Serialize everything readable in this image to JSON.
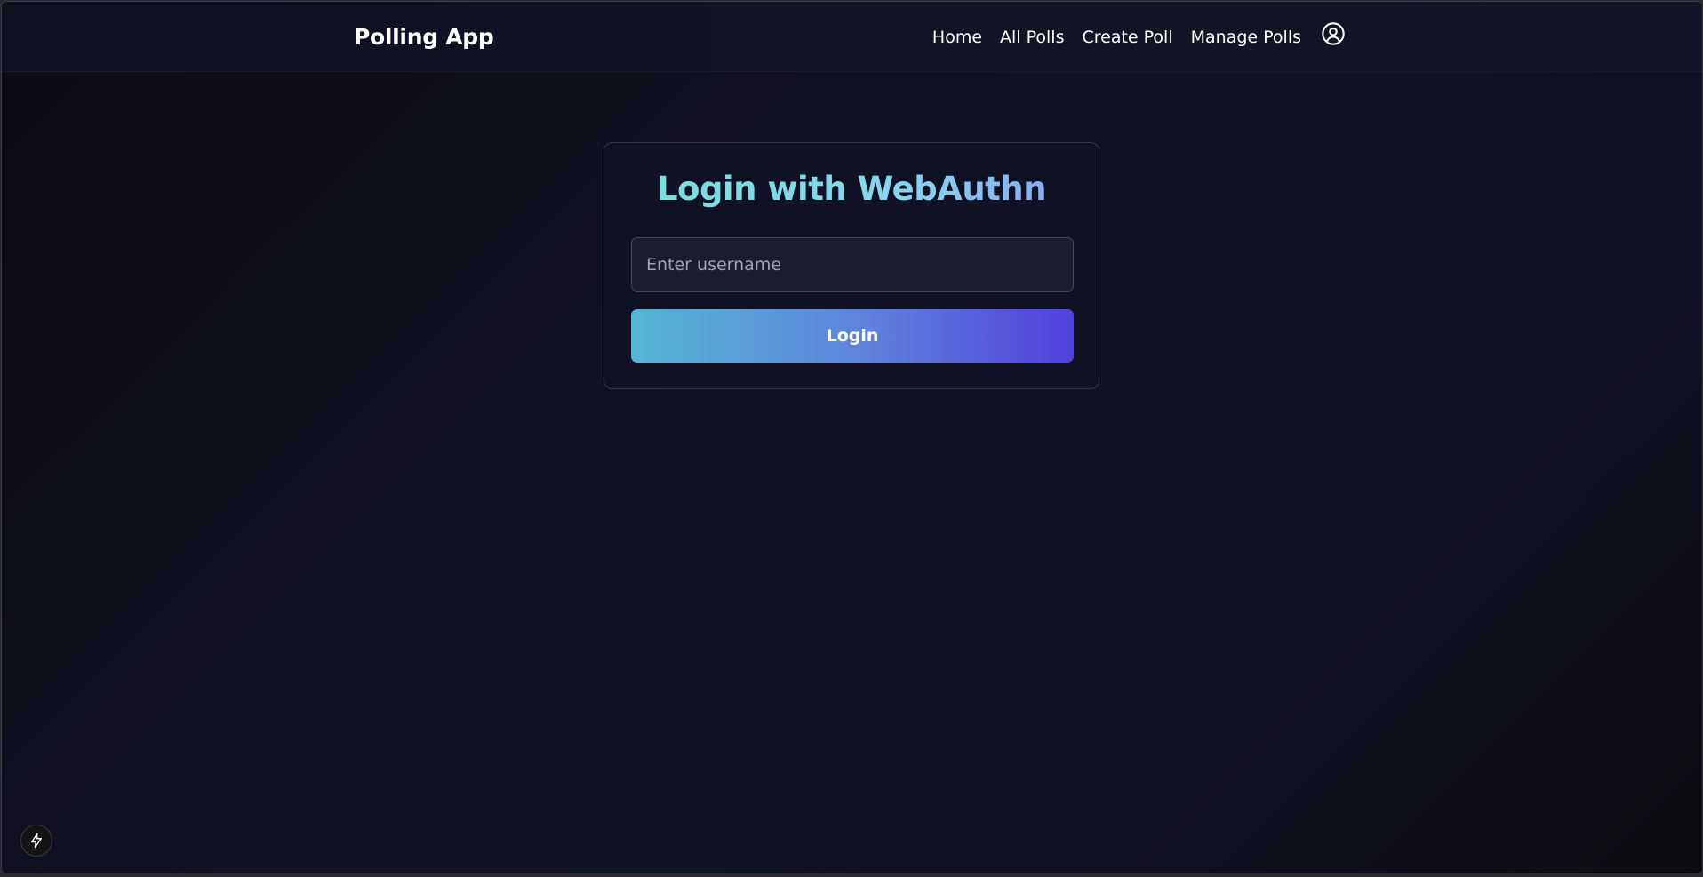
{
  "header": {
    "brand": "Polling App",
    "nav": [
      {
        "label": "Home"
      },
      {
        "label": "All Polls"
      },
      {
        "label": "Create Poll"
      },
      {
        "label": "Manage Polls"
      }
    ],
    "avatar_icon": "user-circle-icon"
  },
  "login_card": {
    "title": "Login with WebAuthn",
    "username_input": {
      "value": "",
      "placeholder": "Enter username"
    },
    "login_button": "Login"
  },
  "floating_button": {
    "icon": "lightning-bolt-icon"
  },
  "colors": {
    "background": "#0f1022",
    "card_border": "#34364a",
    "title_gradient_start": "#79e0d8",
    "title_gradient_end": "#8e9cf0",
    "button_gradient_start": "#56b6d4",
    "button_gradient_end": "#5141dc"
  }
}
